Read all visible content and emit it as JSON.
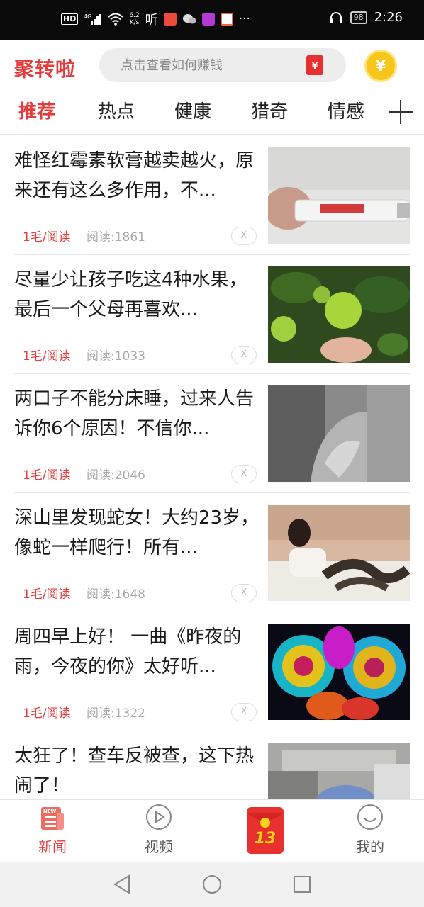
{
  "status_bar": {
    "speed_value": "6.2",
    "speed_unit": "K/s",
    "ting": "听",
    "more": "···",
    "battery": "98",
    "time": "2:26"
  },
  "header": {
    "logo": "聚转啦",
    "search_placeholder": "点击查看如何赚钱",
    "redpacket_glyph": "¥",
    "coin_glyph": "¥"
  },
  "tabs": [
    "推荐",
    "热点",
    "健康",
    "猎奇",
    "情感"
  ],
  "articles": [
    {
      "title": "难怪红霉素软膏越卖越火，原来还有这么多作用，不...",
      "reward": "1毛/阅读",
      "reads": "阅读:1861"
    },
    {
      "title": "尽量少让孩子吃这4种水果，最后一个父母再喜欢...",
      "reward": "1毛/阅读",
      "reads": "阅读:1033"
    },
    {
      "title": "两口子不能分床睡，过来人告诉你6个原因！不信你...",
      "reward": "1毛/阅读",
      "reads": "阅读:2046"
    },
    {
      "title": "深山里发现蛇女！大约23岁，像蛇一样爬行！所有...",
      "reward": "1毛/阅读",
      "reads": "阅读:1648"
    },
    {
      "title": "周四早上好！ 一曲《昨夜的雨，今夜的你》太好听...",
      "reward": "1毛/阅读",
      "reads": "阅读:1322"
    },
    {
      "title": "太狂了！查车反被查，这下热闹了！",
      "reward": "",
      "reads": ""
    }
  ],
  "close_label": "X",
  "bottom_nav": {
    "news": "新闻",
    "news_badge": "NEW",
    "video": "视频",
    "packet_count": "13",
    "mine": "我的"
  },
  "colors": {
    "accent": "#e63b3b",
    "coin": "#f6c61a",
    "search_bg": "#ededed"
  }
}
